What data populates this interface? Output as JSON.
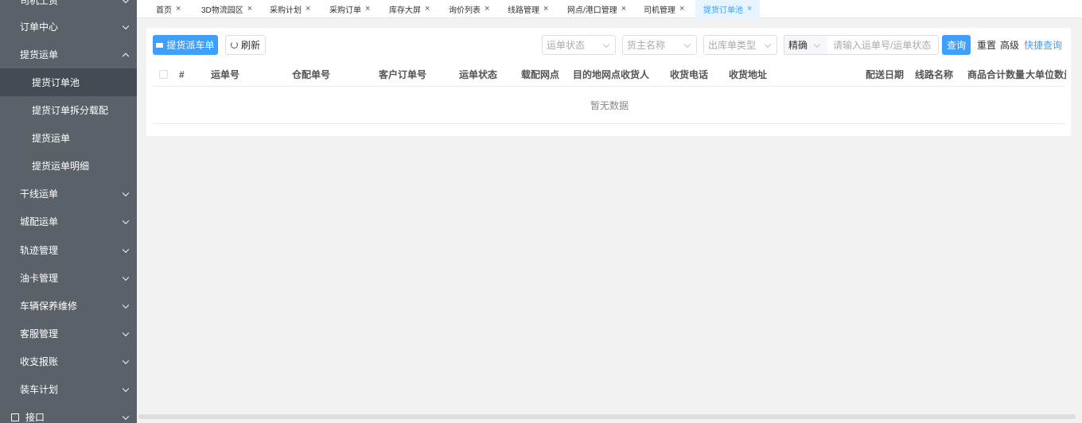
{
  "sidebar": {
    "items": [
      {
        "label": "司机工资",
        "chevron": "down",
        "active": false,
        "sub": false
      },
      {
        "label": "订单中心",
        "chevron": "down",
        "active": false,
        "sub": false
      },
      {
        "label": "提货运单",
        "chevron": "up",
        "active": false,
        "sub": false
      },
      {
        "label": "提货订单池",
        "chevron": "",
        "active": true,
        "sub": true
      },
      {
        "label": "提货订单拆分载配",
        "chevron": "",
        "active": false,
        "sub": true
      },
      {
        "label": "提货运单",
        "chevron": "",
        "active": false,
        "sub": true
      },
      {
        "label": "提货运单明细",
        "chevron": "",
        "active": false,
        "sub": true
      },
      {
        "label": "干线运单",
        "chevron": "down",
        "active": false,
        "sub": false
      },
      {
        "label": "城配运单",
        "chevron": "down",
        "active": false,
        "sub": false
      },
      {
        "label": "轨迹管理",
        "chevron": "down",
        "active": false,
        "sub": false
      },
      {
        "label": "油卡管理",
        "chevron": "down",
        "active": false,
        "sub": false
      },
      {
        "label": "车辆保养维修",
        "chevron": "down",
        "active": false,
        "sub": false
      },
      {
        "label": "客服管理",
        "chevron": "down",
        "active": false,
        "sub": false
      },
      {
        "label": "收支报账",
        "chevron": "down",
        "active": false,
        "sub": false
      },
      {
        "label": "装车计划",
        "chevron": "down",
        "active": false,
        "sub": false
      },
      {
        "label": "接口",
        "chevron": "down",
        "active": false,
        "sub": false
      }
    ]
  },
  "tabs": [
    {
      "label": "首页",
      "active": false
    },
    {
      "label": "3D物流园区",
      "active": false
    },
    {
      "label": "采购计划",
      "active": false
    },
    {
      "label": "采购订单",
      "active": false
    },
    {
      "label": "库存大屏",
      "active": false
    },
    {
      "label": "询价列表",
      "active": false
    },
    {
      "label": "线路管理",
      "active": false
    },
    {
      "label": "网点/港口管理",
      "active": false
    },
    {
      "label": "司机管理",
      "active": false
    },
    {
      "label": "提货订单池",
      "active": true
    }
  ],
  "toolbar": {
    "dispatch_label": "提货派车单",
    "refresh_label": "刷新",
    "status_placeholder": "运单状态",
    "owner_placeholder": "货主名称",
    "outbound_placeholder": "出库单类型",
    "match_mode": "精确",
    "search_placeholder": "请输入运单号/运单状态",
    "query_label": "查询",
    "reset_label": "重置",
    "advanced_label": "高级",
    "quick_query_label": "快捷查询"
  },
  "table": {
    "columns": [
      "#",
      "运单号",
      "仓配单号",
      "客户订单号",
      "运单状态",
      "载配网点",
      "目的地网点",
      "收货人",
      "收货电话",
      "收货地址",
      "配送日期",
      "线路名称",
      "商品合计数量",
      "大单位数量"
    ],
    "empty_text": "暂无数据"
  },
  "colors": {
    "primary": "#409eff",
    "sidebar_bg": "#5b6168",
    "sidebar_active": "#454b52"
  }
}
